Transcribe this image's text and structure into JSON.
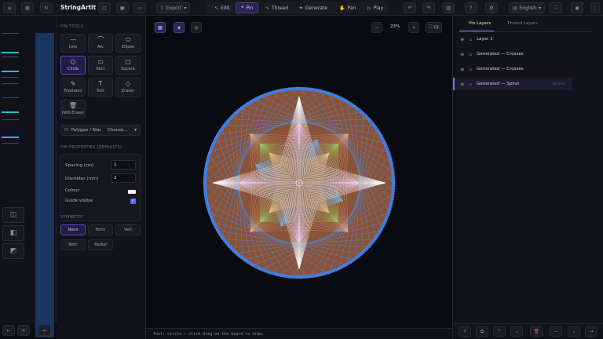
{
  "header": {
    "brand": "StringArtit",
    "export_label": "Export",
    "modes": [
      {
        "label": "Edit",
        "icon": "pointer-icon"
      },
      {
        "label": "Pin",
        "icon": "pin-icon"
      },
      {
        "label": "Thread",
        "icon": "thread-icon"
      },
      {
        "label": "Generate",
        "icon": "sparkle-icon"
      },
      {
        "label": "Pan",
        "icon": "hand-icon"
      },
      {
        "label": "Play",
        "icon": "play-icon"
      }
    ],
    "active_mode": "Pin",
    "language": "English"
  },
  "tools_panel": {
    "title": "PIN TOOLS",
    "tools": [
      {
        "label": "Line",
        "icon": "line-icon"
      },
      {
        "label": "Arc",
        "icon": "arc-icon"
      },
      {
        "label": "Ellipse",
        "icon": "ellipse-icon"
      },
      {
        "label": "Circle",
        "icon": "circle-icon"
      },
      {
        "label": "Rect",
        "icon": "rect-icon"
      },
      {
        "label": "Square",
        "icon": "square-icon"
      },
      {
        "label": "Freehand",
        "icon": "freehand-icon"
      },
      {
        "label": "Text",
        "icon": "text-icon"
      },
      {
        "label": "Eraser",
        "icon": "eraser-icon"
      },
      {
        "label": "Path Eraser",
        "icon": "path-eraser-icon"
      }
    ],
    "active_tool": "Circle",
    "polygon_label": "Polygon / Star",
    "polygon_value": "Choose...",
    "properties_title": "PIN PROPERTIES (DEFAULTS)",
    "spacing_label": "Spacing (cm)",
    "spacing_value": "1",
    "diameter_label": "Diameter (mm)",
    "diameter_value": "2",
    "colour_label": "Colour",
    "colour_value": "#f1f1f1",
    "guide_label": "Guide visible",
    "guide_checked": true,
    "symmetry_title": "SYMMETRY",
    "symmetry": [
      "None",
      "Horiz",
      "Vert",
      "Both",
      "Radial"
    ],
    "active_symmetry": "None"
  },
  "canvas": {
    "zoom": "23%",
    "fit_label": "Fit",
    "status": "Tool: circle — click-drag on the board to draw.",
    "board_color": "#8a5236",
    "ring_color": "#3f7be0"
  },
  "layers_panel": {
    "tabs": [
      "Pin Layers",
      "Thread Layers"
    ],
    "active_tab": "Pin Layers",
    "layers": [
      {
        "name": "Layer 1",
        "meta": ""
      },
      {
        "name": "Generated — Crosses",
        "meta": ""
      },
      {
        "name": "Generated — Crosses",
        "meta": ""
      },
      {
        "name": "Generated — Spiral",
        "meta": "Vis  Hid"
      }
    ],
    "selected_index": 3
  }
}
